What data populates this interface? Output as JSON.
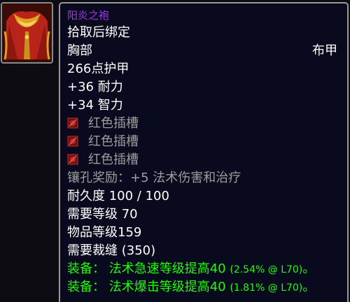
{
  "item": {
    "name": "阳炎之袍",
    "binding": "拾取后绑定",
    "slot": "胸部",
    "armor_type": "布甲",
    "armor": "266点护甲",
    "stats": [
      "+36 耐力",
      "+34 智力"
    ],
    "sockets": [
      {
        "label": "红色插槽",
        "icon": "red-socket-icon"
      },
      {
        "label": "红色插槽",
        "icon": "red-socket-icon"
      },
      {
        "label": "红色插槽",
        "icon": "red-socket-icon"
      }
    ],
    "socket_bonus": "镶孔奖励：+5 法术伤害和治疗",
    "durability": "耐久度 100 / 100",
    "required_level": "需要等级 70",
    "item_level": "物品等级159",
    "requires_skill": "需要裁缝 (350)",
    "equip_effects": [
      {
        "text": "装备：  法术急速等级提高40 ",
        "detail": "(2.54% @ L70)",
        "end": "。"
      },
      {
        "text": "装备：  法术爆击等级提高40 ",
        "detail": "(1.81% @ L70)",
        "end": "。"
      }
    ],
    "icon": "robe-icon"
  },
  "colors": {
    "epic_name": "#a335ee",
    "text_white": "#ffffff",
    "text_gray": "#9d9d9d",
    "equip_green": "#1eff00",
    "background": "#0a0a1e",
    "border": "#9a9a9a"
  }
}
